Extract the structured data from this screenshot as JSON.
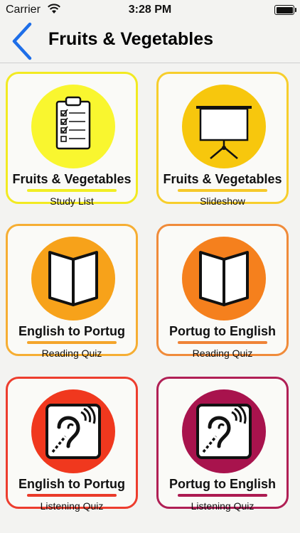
{
  "status_bar": {
    "carrier": "Carrier",
    "time": "3:28 PM"
  },
  "nav": {
    "title": "Fruits & Vegetables",
    "back_icon": "chevron-left-icon",
    "accent_color": "#1e6ee8"
  },
  "tiles": [
    {
      "title": "Fruits & Vegetables",
      "subtitle": "Study List",
      "icon": "clipboard-icon",
      "border_color": "#f2ea22",
      "circle_color": "#f9f62f",
      "underline_color": "#f1ee24"
    },
    {
      "title": "Fruits & Vegetables",
      "subtitle": "Slideshow",
      "icon": "projector-screen-icon",
      "border_color": "#f7ce2c",
      "circle_color": "#f7c70d",
      "underline_color": "#f6c92a"
    },
    {
      "title": "English to Portug",
      "subtitle": "Reading Quiz",
      "icon": "open-book-icon",
      "border_color": "#f6ae33",
      "circle_color": "#f7a21a",
      "underline_color": "#f4a52b"
    },
    {
      "title": "Portug to English",
      "subtitle": "Reading Quiz",
      "icon": "open-book-icon",
      "border_color": "#f08b3a",
      "circle_color": "#f5801d",
      "underline_color": "#ef8337"
    },
    {
      "title": "English to Portug",
      "subtitle": "Listening Quiz",
      "icon": "hearing-ear-icon",
      "border_color": "#ed3d2e",
      "circle_color": "#f0381e",
      "underline_color": "#ea3b2a"
    },
    {
      "title": "Portug to English",
      "subtitle": "Listening Quiz",
      "icon": "hearing-ear-icon",
      "border_color": "#b01f55",
      "circle_color": "#a8134d",
      "underline_color": "#ac1b51"
    }
  ]
}
